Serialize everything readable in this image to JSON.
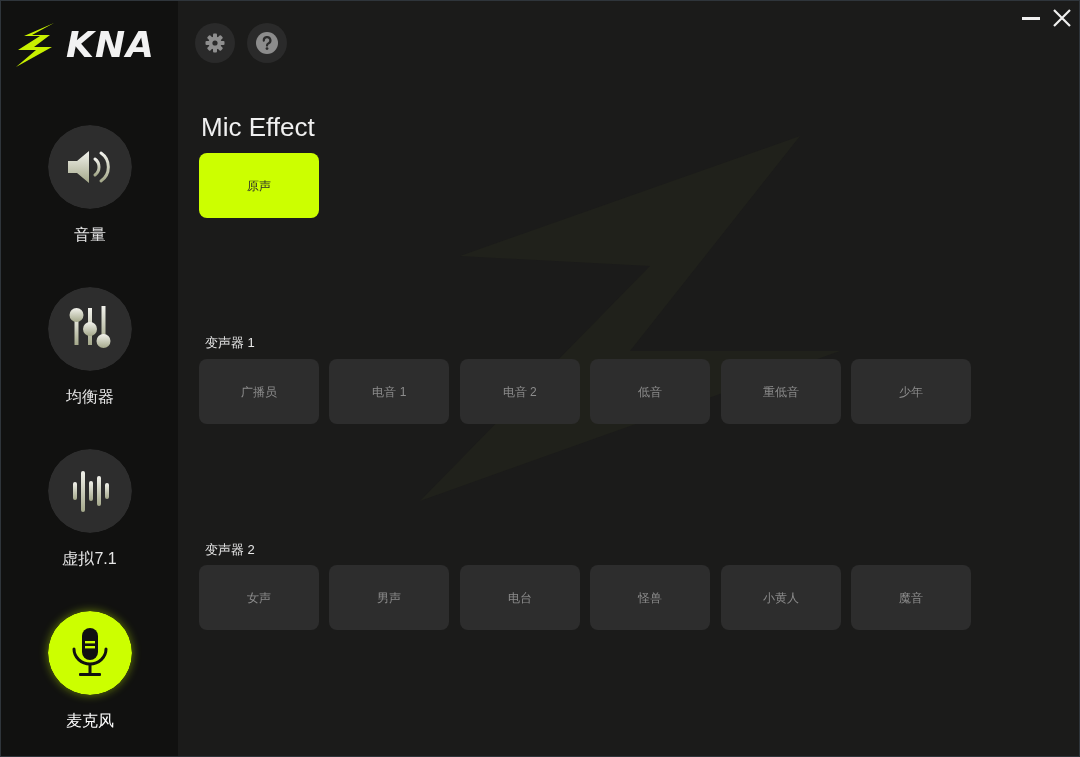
{
  "brand": {
    "logo_text": "KNA"
  },
  "sidebar": {
    "items": [
      {
        "label": "音量",
        "kind": "speaker",
        "selected": false
      },
      {
        "label": "均衡器",
        "kind": "equalizer",
        "selected": false
      },
      {
        "label": "虚拟7.1",
        "kind": "waveform",
        "selected": false
      },
      {
        "label": "麦克风",
        "kind": "microphone",
        "selected": true
      }
    ]
  },
  "page": {
    "title": "Mic Effect"
  },
  "original_effect": {
    "label": "原声",
    "selected": true
  },
  "effect_groups": [
    {
      "title": "变声器 1",
      "effects": [
        {
          "label": "广播员",
          "selected": false
        },
        {
          "label": "电音 1",
          "selected": false
        },
        {
          "label": "电音 2",
          "selected": false
        },
        {
          "label": "低音",
          "selected": false
        },
        {
          "label": "重低音",
          "selected": false
        },
        {
          "label": "少年",
          "selected": false
        }
      ]
    },
    {
      "title": "变声器 2",
      "effects": [
        {
          "label": "女声",
          "selected": false
        },
        {
          "label": "男声",
          "selected": false
        },
        {
          "label": "电台",
          "selected": false
        },
        {
          "label": "怪兽",
          "selected": false
        },
        {
          "label": "小黄人",
          "selected": false
        },
        {
          "label": "魔音",
          "selected": false
        }
      ]
    }
  ]
}
